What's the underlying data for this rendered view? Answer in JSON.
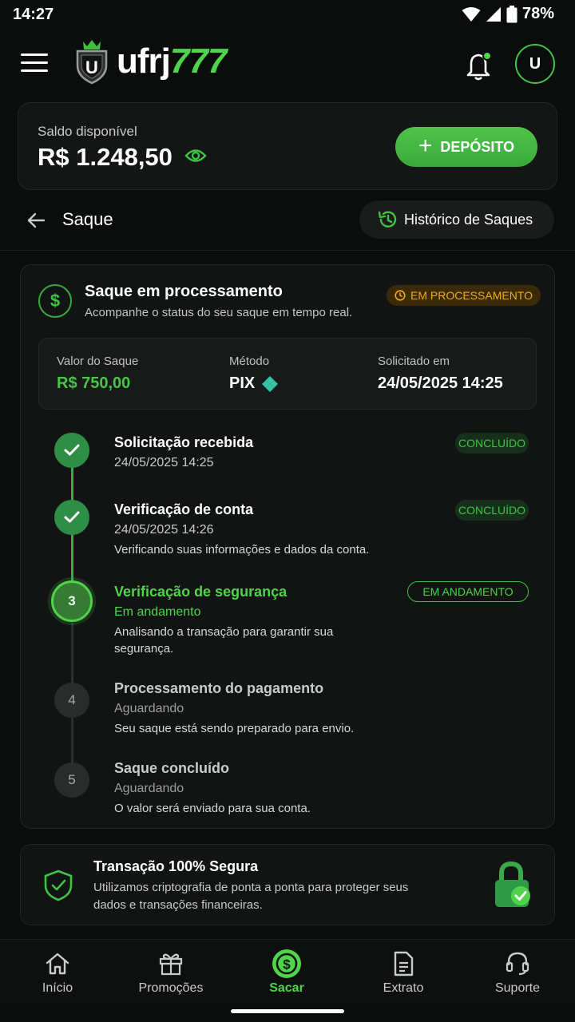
{
  "status_bar": {
    "time": "14:27",
    "battery": "78%"
  },
  "header": {
    "logo_white": "ufrj",
    "logo_green": "777",
    "shield_letter": "U",
    "avatar_initial": "U"
  },
  "balance": {
    "label": "Saldo disponível",
    "value": "R$ 1.248,50",
    "deposit_label": "DEPÓSITO"
  },
  "page": {
    "title": "Saque",
    "history_button": "Histórico de Saques"
  },
  "processing": {
    "icon_symbol": "$",
    "title": "Saque em processamento",
    "subtitle": "Acompanhe o status do seu saque em tempo real.",
    "badge": "EM PROCESSAMENTO",
    "amount_label": "Valor do Saque",
    "amount_value": "R$ 750,00",
    "method_label": "Método",
    "method_value": "PIX",
    "requested_label": "Solicitado em",
    "requested_value": "24/05/2025 14:25"
  },
  "steps": [
    {
      "number": "1",
      "title": "Solicitação recebida",
      "subtitle": "24/05/2025 14:25",
      "description": "",
      "badge": "CONCLUÍDO",
      "state": "done"
    },
    {
      "number": "2",
      "title": "Verificação de conta",
      "subtitle": "24/05/2025 14:26",
      "description": "Verificando suas informações e dados da conta.",
      "badge": "CONCLUÍDO",
      "state": "done"
    },
    {
      "number": "3",
      "title": "Verificação de segurança",
      "subtitle": "Em andamento",
      "description": "Analisando a transação para garantir sua segurança.",
      "badge": "EM ANDAMENTO",
      "state": "active"
    },
    {
      "number": "4",
      "title": "Processamento do pagamento",
      "subtitle": "Aguardando",
      "description": "Seu saque está sendo preparado para envio.",
      "badge": "",
      "state": "pending"
    },
    {
      "number": "5",
      "title": "Saque concluído",
      "subtitle": "Aguardando",
      "description": "O valor será enviado para sua conta.",
      "badge": "",
      "state": "pending"
    }
  ],
  "security": {
    "title": "Transação 100% Segura",
    "description": "Utilizamos criptografia de ponta a ponta para proteger seus dados e transações financeiras."
  },
  "nav": [
    {
      "label": "Início",
      "icon": "home-icon"
    },
    {
      "label": "Promoções",
      "icon": "gift-icon"
    },
    {
      "label": "Sacar",
      "icon": "dollar-icon"
    },
    {
      "label": "Extrato",
      "icon": "document-icon"
    },
    {
      "label": "Suporte",
      "icon": "headset-icon"
    }
  ],
  "colors": {
    "accent": "#4fd34a",
    "warning": "#f0a91b",
    "background": "#0b0c0c",
    "card": "#121413"
  }
}
